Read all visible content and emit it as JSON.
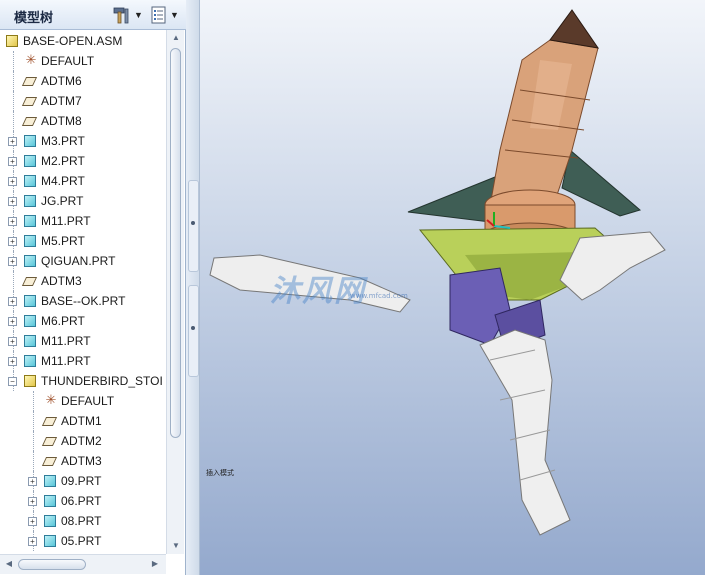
{
  "panel": {
    "title": "模型树"
  },
  "tree": [
    {
      "label": "BASE-OPEN.ASM",
      "icon": "assembly",
      "expand": "",
      "level": 0
    },
    {
      "label": "DEFAULT",
      "icon": "csys",
      "expand": "",
      "level": 1
    },
    {
      "label": "ADTM6",
      "icon": "datum",
      "expand": "",
      "level": 1
    },
    {
      "label": "ADTM7",
      "icon": "datum",
      "expand": "",
      "level": 1
    },
    {
      "label": "ADTM8",
      "icon": "datum",
      "expand": "",
      "level": 1
    },
    {
      "label": "M3.PRT",
      "icon": "part",
      "expand": "+",
      "level": 1
    },
    {
      "label": "M2.PRT",
      "icon": "part",
      "expand": "+",
      "level": 1
    },
    {
      "label": "M4.PRT",
      "icon": "part",
      "expand": "+",
      "level": 1
    },
    {
      "label": "JG.PRT",
      "icon": "part",
      "expand": "+",
      "level": 1
    },
    {
      "label": "M11.PRT",
      "icon": "part",
      "expand": "+",
      "level": 1
    },
    {
      "label": "M5.PRT",
      "icon": "part",
      "expand": "+",
      "level": 1
    },
    {
      "label": "QIGUAN.PRT",
      "icon": "part",
      "expand": "+",
      "level": 1
    },
    {
      "label": "ADTM3",
      "icon": "datum",
      "expand": "",
      "level": 1
    },
    {
      "label": "BASE--OK.PRT",
      "icon": "part",
      "expand": "+",
      "level": 1
    },
    {
      "label": "M6.PRT",
      "icon": "part",
      "expand": "+",
      "level": 1
    },
    {
      "label": "M11.PRT",
      "icon": "part",
      "expand": "+",
      "level": 1
    },
    {
      "label": "M11.PRT",
      "icon": "part",
      "expand": "+",
      "level": 1
    },
    {
      "label": "THUNDERBIRD_STOI",
      "icon": "assembly",
      "expand": "−",
      "level": 1
    },
    {
      "label": "DEFAULT",
      "icon": "csys",
      "expand": "",
      "level": 2
    },
    {
      "label": "ADTM1",
      "icon": "datum",
      "expand": "",
      "level": 2
    },
    {
      "label": "ADTM2",
      "icon": "datum",
      "expand": "",
      "level": 2
    },
    {
      "label": "ADTM3",
      "icon": "datum",
      "expand": "",
      "level": 2
    },
    {
      "label": "09.PRT",
      "icon": "part",
      "expand": "+",
      "level": 2
    },
    {
      "label": "06.PRT",
      "icon": "part",
      "expand": "+",
      "level": 2
    },
    {
      "label": "08.PRT",
      "icon": "part",
      "expand": "+",
      "level": 2
    },
    {
      "label": "05.PRT",
      "icon": "part",
      "expand": "+",
      "level": 2
    }
  ],
  "viewport": {
    "mode_label": "插入模式",
    "watermark": "沐风网",
    "watermark_sub": "www.mfcad.com"
  },
  "colors": {
    "accent": "#5aa0d6",
    "part_icon": "#58c6d8",
    "assembly_icon": "#e2c64a"
  }
}
